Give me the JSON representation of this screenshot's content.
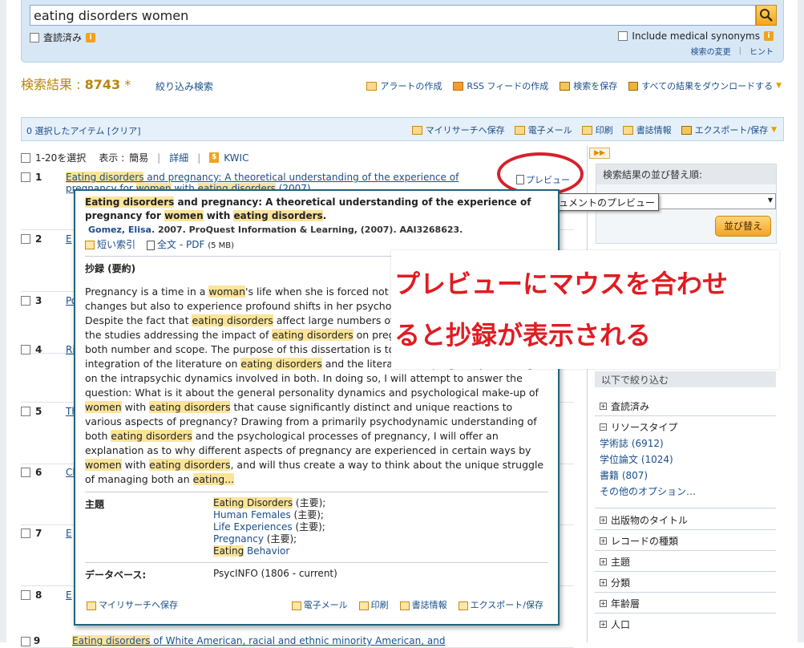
{
  "search": {
    "query": "eating disorders women",
    "peer_reviewed_label": "査読済み",
    "medical_synonyms_label": "Include medical synonyms",
    "change_search_link": "検索の変更",
    "tips_link": "ヒント",
    "sep": "|"
  },
  "results": {
    "label": "検索結果 : ",
    "count": "8743",
    "star": "*",
    "refine_link": "絞り込み検索",
    "tools": [
      "アラートの作成",
      "RSS フィードの作成",
      "検索を保存",
      "すべての結果をダウンロードする"
    ]
  },
  "selection_bar": {
    "selected_text": "0 選択したアイテム",
    "clear_link": "[クリア]",
    "actions": [
      "マイリサーチへ保存",
      "電子メール",
      "印刷",
      "書誌情報",
      "エクスポート/保存"
    ]
  },
  "list_header": {
    "select_label": "1-20を選択",
    "view_label": "表示 :",
    "brief": "簡易",
    "detail": "詳細",
    "kwic": "KWIC",
    "sep": "|"
  },
  "result_1": {
    "num": "1",
    "title_hl": "Eating disorders",
    "title_rest": " and pregnancy: A theoretical understanding of the experience of",
    "title_line2_a": "pregnancy for ",
    "title_line2_hl1": "women",
    "title_line2_b": " with ",
    "title_line2_hl2": "eating disorders",
    "title_line2_c": " (2007)"
  },
  "result_nums": [
    "2",
    "3",
    "4",
    "5",
    "6",
    "7",
    "8"
  ],
  "result_partial_titles": [
    "E",
    "Po",
    "Ri",
    "Th",
    "Cl",
    "E",
    "E"
  ],
  "last_result": {
    "num": "9",
    "title_hl": "Eating disorders",
    "title_rest": " of White American, racial and ethnic minority American, and"
  },
  "preview_link": "プレビュー",
  "tooltip": "ドキュメントのプレビュー",
  "popup": {
    "title_hl": "Eating disorders",
    "title_a": " and pregnancy: A theoretical understanding of the experience of pregnancy for ",
    "title_hl2": "women",
    "title_b": " with ",
    "title_hl3": "eating disorders",
    "title_c": ".",
    "author": "Gomez, Elisa.",
    "citation": " 2007. ProQuest Information & Learning, (2007). AAI3268623.",
    "short_index": "短い索引",
    "fulltext": "全文 - PDF",
    "size": "(5 MB)",
    "abstract_label": "抄録 (要約)",
    "abstract": [
      {
        "t": "Pregnancy is a time in a "
      },
      {
        "h": "woman"
      },
      {
        "t": "'s life when she is forced not only to experience physical changes but also to experience profound shifts in her psychological self and in her life. Despite the fact that "
      },
      {
        "h": "eating disorders"
      },
      {
        "t": " affect large numbers of women of child-bearing age, the studies addressing the impact of "
      },
      {
        "h": "eating disorders"
      },
      {
        "t": " on pregnancy have been limited in both number and scope. The purpose of this dissertation is to create a theoretical integration of the literature on "
      },
      {
        "h": "eating disorders"
      },
      {
        "t": " and the literature on pregnancy, focusing on the intrapsychic dynamics involved in both. In doing so, I will attempt to answer the question: What is it about the general personality dynamics and psychological make-up of "
      },
      {
        "h": "women"
      },
      {
        "t": " with "
      },
      {
        "h": "eating disorders"
      },
      {
        "t": " that cause significantly distinct and unique reactions to various aspects of pregnancy? Drawing from a primarily psychodynamic understanding of both "
      },
      {
        "h": "eating disorders"
      },
      {
        "t": " and the psychological processes of pregnancy, I will offer an explanation as to why different aspects of pregnancy are experienced in certain ways by "
      },
      {
        "h": "women"
      },
      {
        "t": " with "
      },
      {
        "h": "eating disorders"
      },
      {
        "t": ", and will thus create a way to think about the unique struggle of managing both an "
      },
      {
        "h": "eating..."
      }
    ],
    "subject_label": "主題",
    "subjects": [
      {
        "hl": "Eating Disorders",
        "link": "",
        "tag": " (主要);"
      },
      {
        "hl": "",
        "link": "Human Females",
        "tag": " (主要);"
      },
      {
        "hl": "",
        "link": "Life Experiences",
        "tag": " (主要);"
      },
      {
        "hl": "",
        "link": "Pregnancy",
        "tag": " (主要);"
      },
      {
        "hl": "Eating",
        "link": " Behavior",
        "tag": ""
      }
    ],
    "db_label": "データベース:",
    "db_value": "PsycINFO (1806 - current)",
    "footer_save": "マイリサーチへ保存",
    "footer_actions": [
      "電子メール",
      "印刷",
      "書誌情報",
      "エクスポート/保存"
    ]
  },
  "annotation": {
    "line1": "プレビューにマウスを合わせ",
    "line2": "ると抄録が表示される"
  },
  "sidebar": {
    "tab": "▶▶",
    "sort_head": "検索結果の並び替え順:",
    "sort_button": "並び替え",
    "filter_head": "以下で絞り込む",
    "facets": [
      {
        "sign": "+",
        "label": "査読済み"
      },
      {
        "sign": "−",
        "label": "リソースタイプ"
      }
    ],
    "resource_types": [
      "学術誌 (6912)",
      "学位論文 (1024)",
      "書籍 (807)",
      "その他のオプション…"
    ],
    "more_facets": [
      "出版物のタイトル",
      "レコードの種類",
      "主題",
      "分類",
      "年齢層",
      "人口"
    ]
  }
}
